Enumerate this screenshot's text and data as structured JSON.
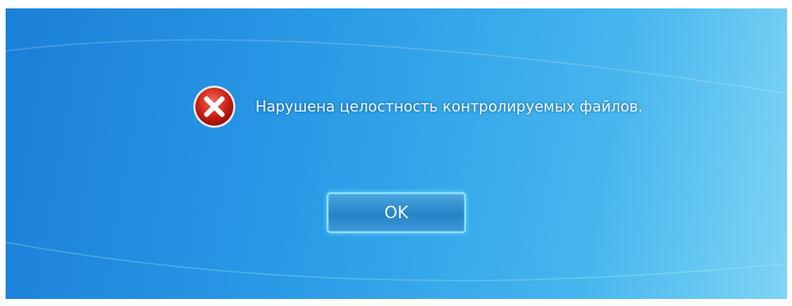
{
  "message": {
    "kind": "error",
    "text": "Нарушена целостность контролируемых файлов."
  },
  "buttons": [
    {
      "label": "OK"
    }
  ]
}
